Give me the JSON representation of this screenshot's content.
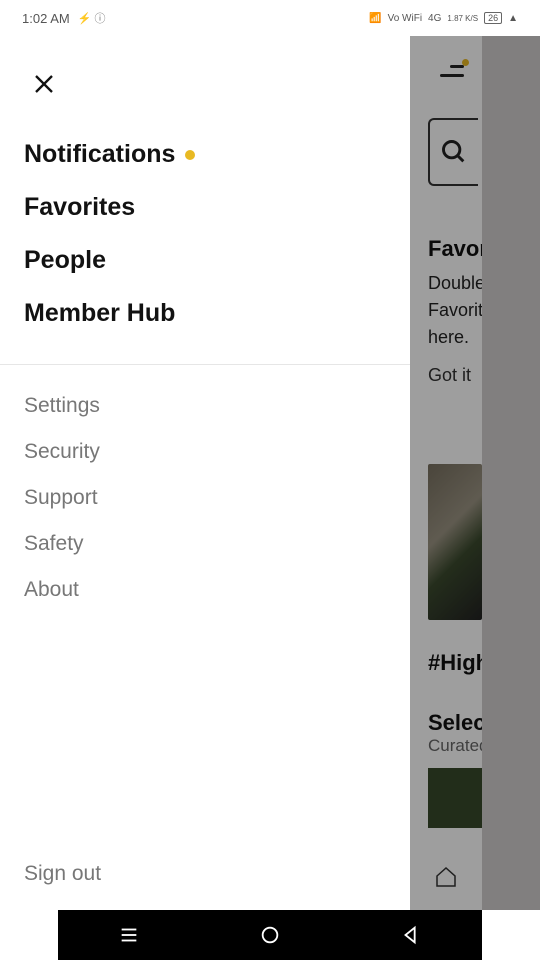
{
  "statusbar": {
    "time": "1:02 AM",
    "network_left_icons": "⚡ ⓘ",
    "wifi": "📶",
    "vowifi": "Vo WiFi",
    "signal": "4G",
    "speed": "1.87 K/S",
    "battery": "26"
  },
  "drawer": {
    "primary": [
      {
        "label": "Notifications",
        "has_dot": true
      },
      {
        "label": "Favorites"
      },
      {
        "label": "People"
      },
      {
        "label": "Member Hub"
      }
    ],
    "secondary": [
      {
        "label": "Settings"
      },
      {
        "label": "Security"
      },
      {
        "label": "Support"
      },
      {
        "label": "Safety"
      },
      {
        "label": "About"
      }
    ],
    "signout": "Sign out"
  },
  "background": {
    "card_title": "Favor",
    "card_line1": "Double",
    "card_line2": "Favorit",
    "card_line3": "here.",
    "gotit": "Got it",
    "hashtag": "#High",
    "section": "Selec",
    "curated": "Curated"
  }
}
